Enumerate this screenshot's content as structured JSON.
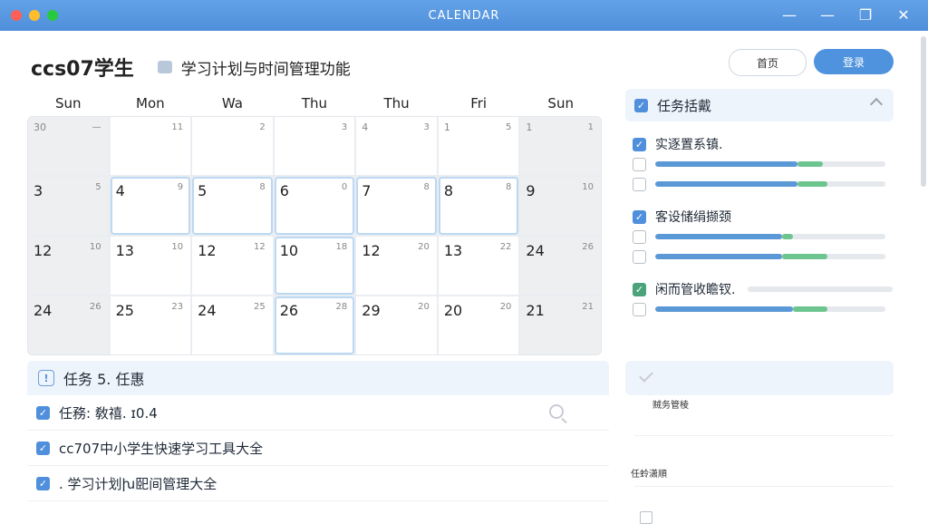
{
  "window": {
    "title": "CALENDAR"
  },
  "brand": {
    "logo": "ccs07学生",
    "subtitle": "学习计划与时间管理功能"
  },
  "buttons": {
    "home": "首页",
    "primary": "登录"
  },
  "calendar": {
    "days": [
      "Sun",
      "Mon",
      "Wa",
      "Thu",
      "Thu",
      "Fri",
      "Sun"
    ],
    "weeks": [
      [
        {
          "n": "30",
          "s": "—"
        },
        {
          "n": "",
          "s": "11"
        },
        {
          "n": "",
          "s": "2"
        },
        {
          "n": "",
          "s": "3"
        },
        {
          "n": "4",
          "s": "3"
        },
        {
          "n": "1",
          "s": "5"
        },
        {
          "n": "1",
          "s": "1"
        }
      ],
      [
        {
          "n": "3",
          "s": "5"
        },
        {
          "n": "4",
          "s": "9"
        },
        {
          "n": "5",
          "s": "8"
        },
        {
          "n": "6",
          "s": "0"
        },
        {
          "n": "7",
          "s": "8"
        },
        {
          "n": "8",
          "s": "8"
        },
        {
          "n": "9",
          "s": "10"
        }
      ],
      [
        {
          "n": "12",
          "s": "10"
        },
        {
          "n": "13",
          "s": "10"
        },
        {
          "n": "12",
          "s": "12"
        },
        {
          "n": "10",
          "s": "18"
        },
        {
          "n": "12",
          "s": "20"
        },
        {
          "n": "13",
          "s": "22"
        },
        {
          "n": "24",
          "s": "26"
        }
      ],
      [
        {
          "n": "24",
          "s": "26"
        },
        {
          "n": "25",
          "s": "23"
        },
        {
          "n": "24",
          "s": "25"
        },
        {
          "n": "26",
          "s": "28"
        },
        {
          "n": "29",
          "s": "20"
        },
        {
          "n": "20",
          "s": "20"
        },
        {
          "n": "21",
          "s": "21"
        }
      ]
    ]
  },
  "tasklist": {
    "header": "任务 5. 任惠",
    "items": [
      {
        "label": "任務: 敎禧. ɪ0.4",
        "checked": true
      },
      {
        "label": "cc707中小学生快速学习工具大全",
        "checked": true
      },
      {
        "label": ". 学习计划խ巸间管理大全",
        "checked": true
      }
    ]
  },
  "rightpanel": {
    "header": "任务括戴",
    "groups": [
      {
        "title": "实逐置系镇.",
        "title_checked": true,
        "progress": [
          0.62,
          0.73,
          0.75
        ],
        "green_from": 0.62
      },
      {
        "title": "客设储绢撷颈",
        "title_checked": true,
        "progress": [
          0.55,
          0.75
        ],
        "green_from": 0.55
      },
      {
        "title": "闲而管收瞻钗.",
        "title_checked": true,
        "progress": [
          0.75
        ],
        "green_from": 0.6
      }
    ]
  },
  "rightpanel2": {
    "label1": "贼务管棱",
    "label2": "任蛉潇順"
  },
  "colors": {
    "accent": "#4f8fdb",
    "green": "#6cc58e"
  }
}
